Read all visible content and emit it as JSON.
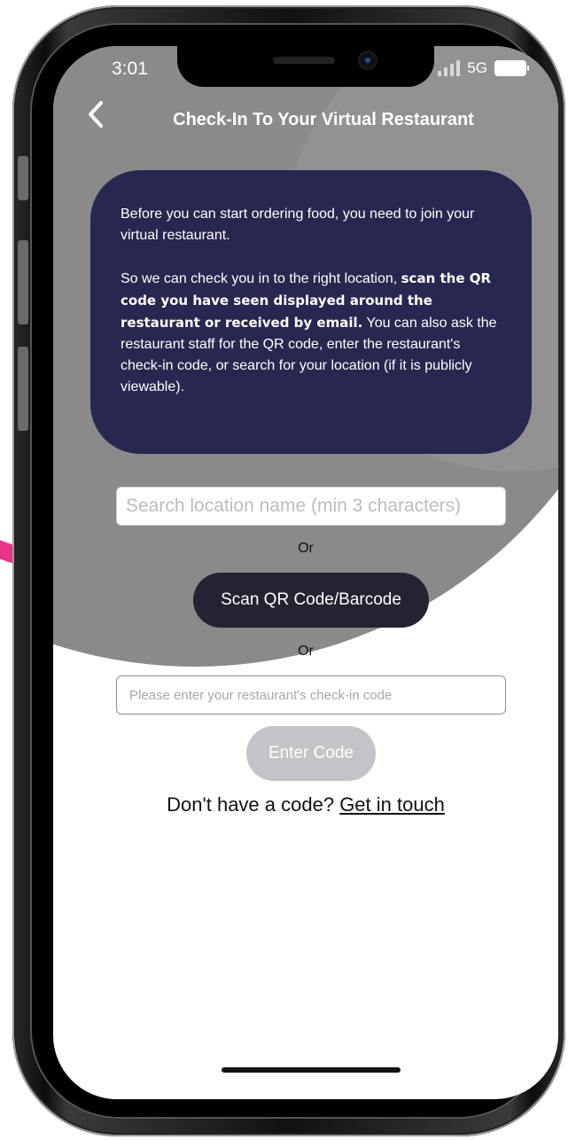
{
  "status_bar": {
    "time": "3:01",
    "network": "5G"
  },
  "header": {
    "title": "Check-In To Your Virtual Restaurant",
    "back_icon": "chevron-left-icon"
  },
  "info_card": {
    "para1": "Before you can start ordering food, you need to join your virtual restaurant.",
    "para2_start": "So we can check you in to the right location, ",
    "para2_bold": "scan the QR code you have seen displayed around the restaurant or received by email.",
    "para2_end": " You can also ask the restaurant staff for the QR code, enter the restaurant's check-in code, or search for your location (if it is publicly viewable)."
  },
  "search": {
    "placeholder": "Search location name (min 3 characters)",
    "value": ""
  },
  "or_label_1": "Or",
  "scan_button_label": "Scan QR Code/Barcode",
  "or_label_2": "Or",
  "code_input": {
    "placeholder": "Please enter your restaurant's check-in code",
    "value": ""
  },
  "enter_button_label": "Enter Code",
  "help": {
    "prefix": "Don't have a code? ",
    "link": "Get in touch"
  },
  "colors": {
    "card_bg": "#28274f",
    "scan_button_bg": "#232331",
    "enter_button_bg": "#c4c4c8",
    "header_circle": "#8a8a8b",
    "arrow": "#e8338a"
  }
}
